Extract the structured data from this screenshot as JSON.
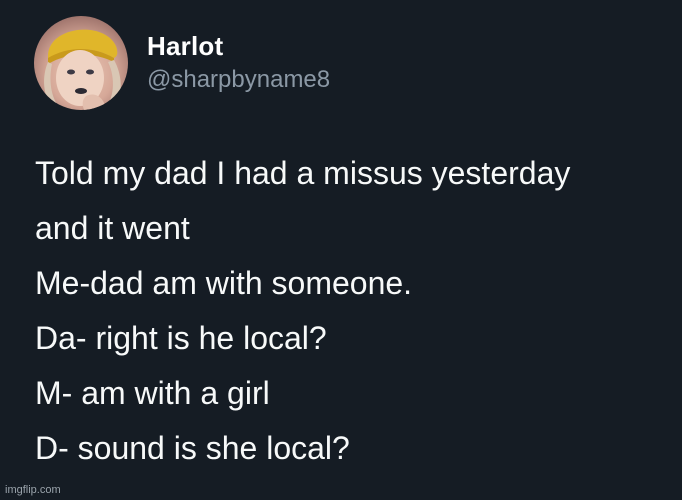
{
  "tweet": {
    "display_name": "Harlot",
    "handle": "@sharpbyname8",
    "lines": [
      "Told my dad I had a missus yesterday",
      "and it went",
      "Me-dad am with someone.",
      "Da- right is he local?",
      "M- am with a girl",
      "D- sound is she local?"
    ]
  },
  "watermark": "imgflip.com",
  "colors": {
    "background": "#151c24",
    "text": "#f7f9f9",
    "handle": "#8b98a5"
  },
  "icons": {
    "avatar": "profile-photo"
  }
}
